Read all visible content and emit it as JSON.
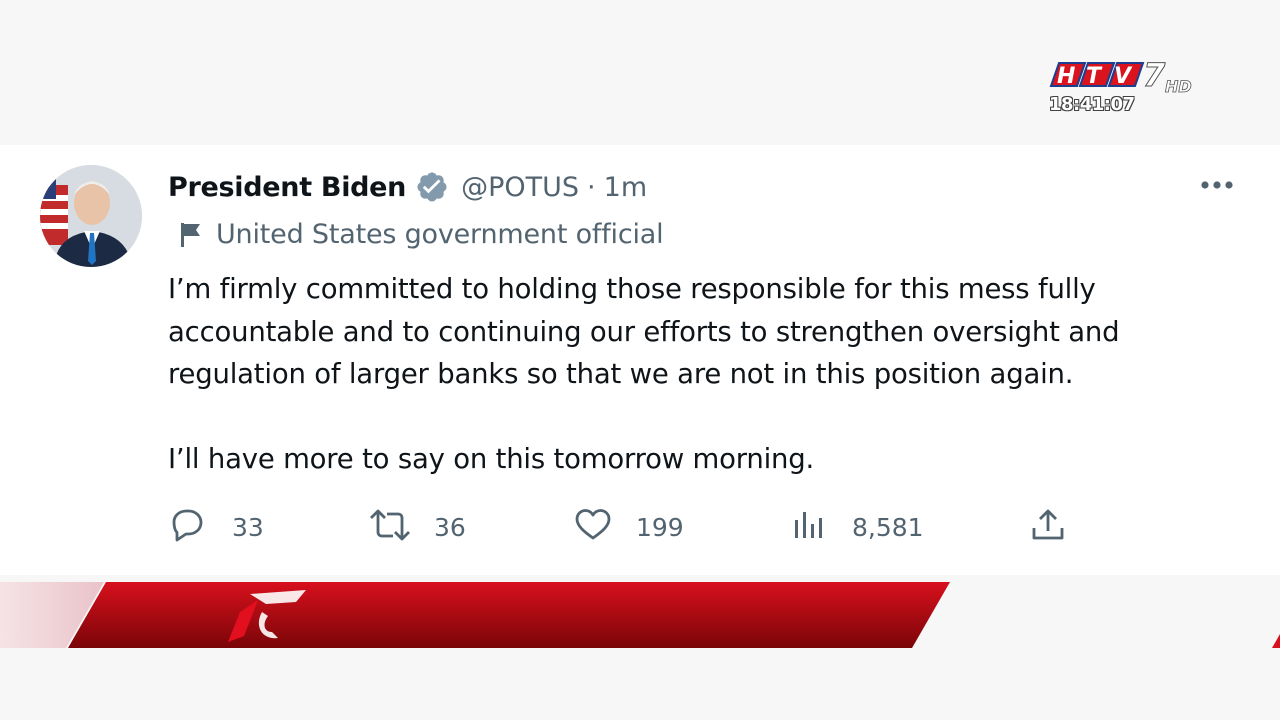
{
  "station": {
    "logo_text": "HTV7 HD",
    "clock": "18:41:07"
  },
  "tweet": {
    "author_name": "President Biden",
    "handle": "@POTUS",
    "separator": "·",
    "timestamp": "1m",
    "label": "United States government official",
    "body": [
      "I’m firmly committed to holding those responsible for this mess fully",
      "accountable and to continuing our efforts to strengthen oversight and",
      "regulation of larger banks so that we are not in this position again.",
      "I’ll have more to say on this tomorrow morning."
    ],
    "actions": {
      "replies": "33",
      "retweets": "36",
      "likes": "199",
      "views": "8,581"
    }
  },
  "icons": [
    "verified-badge-icon",
    "flag-icon",
    "more-icon",
    "reply-icon",
    "retweet-icon",
    "like-icon",
    "views-icon",
    "share-icon"
  ],
  "colors": {
    "text_primary": "#0f1419",
    "text_secondary": "#536471",
    "banner_red": "#c8101e"
  }
}
